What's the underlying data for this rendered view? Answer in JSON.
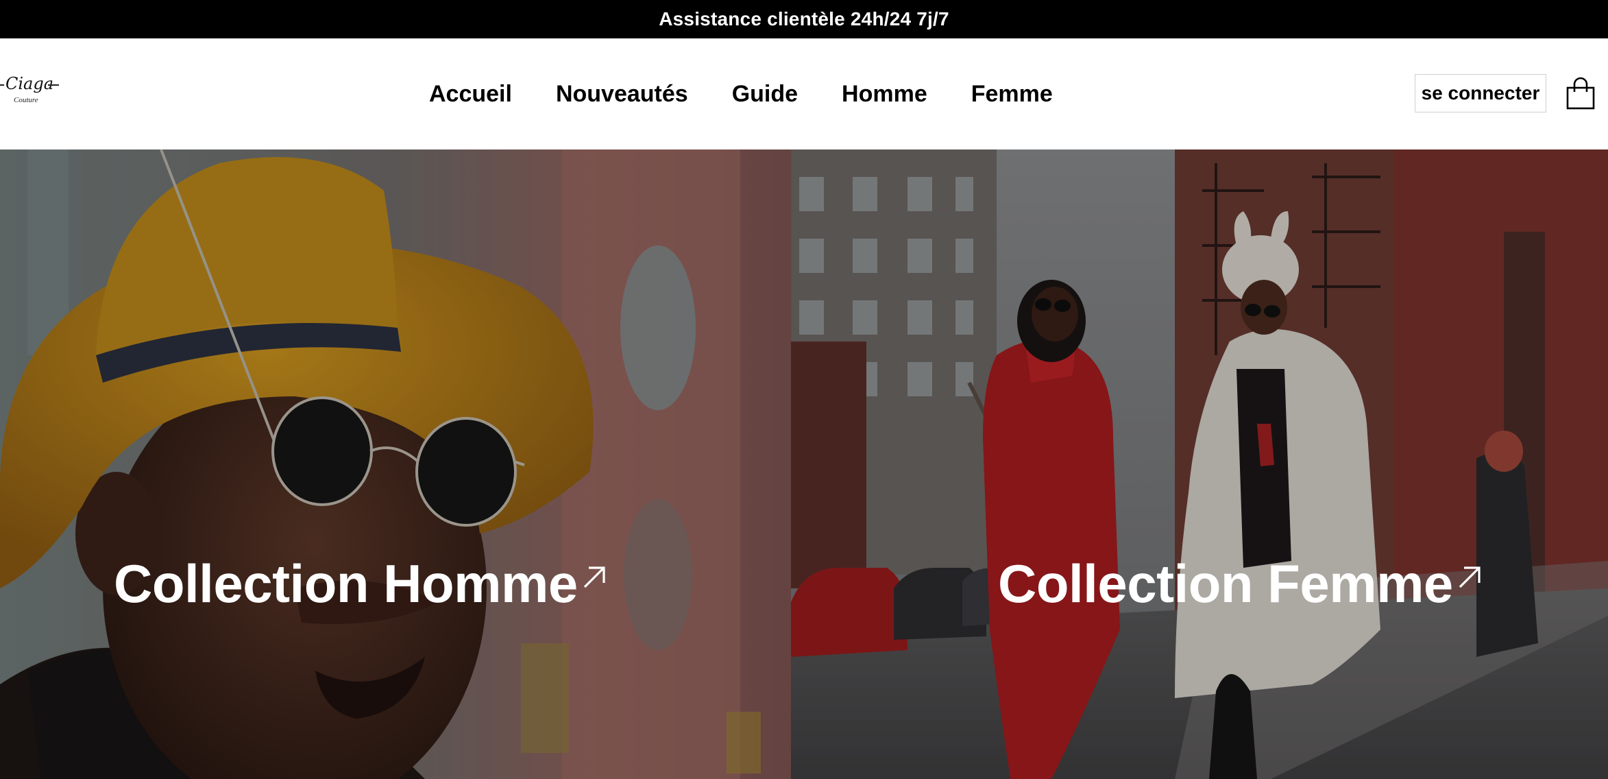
{
  "announcement": {
    "text": "Assistance clientèle 24h/24 7j/7"
  },
  "logo": {
    "name": "Ciaga",
    "subtitle": "Couture"
  },
  "nav": {
    "items": [
      {
        "label": "Accueil"
      },
      {
        "label": "Nouveautés"
      },
      {
        "label": "Guide"
      },
      {
        "label": "Homme"
      },
      {
        "label": "Femme"
      }
    ]
  },
  "header": {
    "login_label": "se connecter",
    "cart_icon": "shopping-bag-icon"
  },
  "hero": {
    "left": {
      "title": "Collection Homme",
      "icon": "arrow-up-right-icon"
    },
    "right": {
      "title": "Collection Femme",
      "icon": "arrow-up-right-icon"
    }
  },
  "colors": {
    "announcement_bg": "#000000",
    "announcement_text": "#ffffff",
    "header_bg": "#ffffff",
    "hero_text": "#ffffff"
  }
}
